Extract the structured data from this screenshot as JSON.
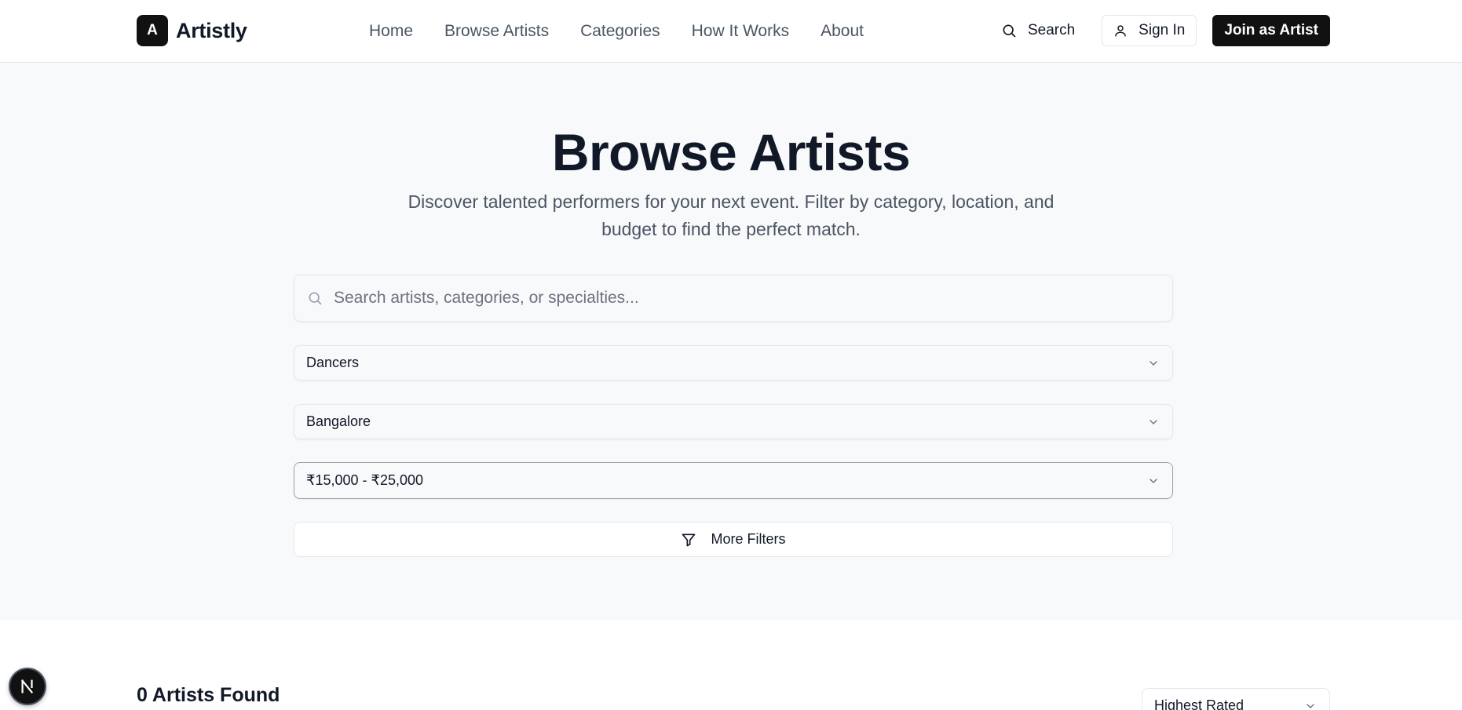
{
  "brand": {
    "logo_letter": "A",
    "name": "Artistly"
  },
  "nav": {
    "items": [
      {
        "label": "Home"
      },
      {
        "label": "Browse Artists"
      },
      {
        "label": "Categories"
      },
      {
        "label": "How It Works"
      },
      {
        "label": "About"
      }
    ]
  },
  "header_actions": {
    "search_label": "Search",
    "signin_label": "Sign In",
    "join_label": "Join as Artist"
  },
  "hero": {
    "title": "Browse Artists",
    "subtitle": "Discover talented performers for your next event. Filter by category, location, and budget to find the perfect match."
  },
  "search": {
    "placeholder": "Search artists, categories, or specialties...",
    "value": ""
  },
  "filters": {
    "category": "Dancers",
    "location": "Bangalore",
    "budget": "₹15,000 - ₹25,000",
    "more_label": "More Filters"
  },
  "results": {
    "count_label": "0 Artists Found",
    "sort_label": "Highest Rated"
  },
  "dev_badge": {
    "letter": "N"
  },
  "colors": {
    "primary": "#111111",
    "hero_bg": "#f8f9fb",
    "text": "#111827",
    "muted": "#4b5563",
    "border": "#e5e7eb"
  }
}
